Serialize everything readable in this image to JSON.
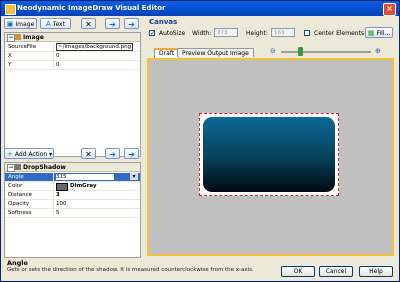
{
  "window": {
    "title": "Neodynamic ImageDraw Visual Editor"
  },
  "toolbar": {
    "image_label": "Image",
    "text_label": "Text"
  },
  "elements_grid": {
    "group": "Image",
    "rows": [
      {
        "key": "SourceFile",
        "value": "~/images/background.png"
      },
      {
        "key": "X",
        "value": "0"
      },
      {
        "key": "Y",
        "value": "0"
      }
    ]
  },
  "actions": {
    "add_label": "Add Action"
  },
  "actions_grid": {
    "group": "DropShadow",
    "rows": [
      {
        "key": "Angle",
        "value": "315"
      },
      {
        "key": "Color",
        "value": "DimGray"
      },
      {
        "key": "Distance",
        "value": "3"
      },
      {
        "key": "Opacity",
        "value": "100"
      },
      {
        "key": "Softness",
        "value": "5"
      }
    ]
  },
  "help": {
    "title": "Angle",
    "desc": "Gets or sets the direction of the shadow. It is measured counterclockwise from the x-axis."
  },
  "canvas": {
    "section": "Canvas",
    "autosize_label": "AutoSize",
    "width_label": "Width:",
    "width_value": "273",
    "height_label": "Height:",
    "height_value": "163",
    "center_label": "Center Elements",
    "fill_label": "Fill...",
    "tab_draft": "Draft",
    "tab_preview": "Preview Output Image",
    "shadow_color": "#696969"
  },
  "buttons": {
    "ok": "OK",
    "cancel": "Cancel",
    "help": "Help"
  }
}
